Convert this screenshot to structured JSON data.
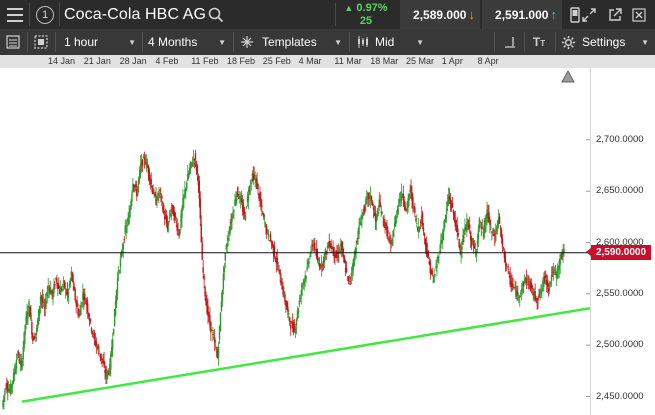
{
  "header": {
    "instrument_id": "1",
    "instrument_name": "Coca-Cola HBC AG",
    "change_pct": "0.97%",
    "change_pts": "25",
    "sell_price": "2,589.000",
    "buy_price": "2,591.000"
  },
  "toolbar": {
    "interval": "1 hour",
    "range": "4 Months",
    "templates": "Templates",
    "price_type": "Mid",
    "settings": "Settings"
  },
  "icons": {
    "menu": "hamburger-icon",
    "search": "search-icon",
    "mobile": "mobile-icon",
    "expand": "expand-icon",
    "popout": "popout-icon",
    "close": "close-icon"
  },
  "colors": {
    "up": "#2e9a2e",
    "down": "#c0181a",
    "trendline": "#41e841",
    "price_line": "#111111",
    "price_tag": "#c8102e"
  },
  "chart_data": {
    "type": "line",
    "x_ticks": [
      "14 Jan",
      "21 Jan",
      "28 Jan",
      "4 Feb",
      "11 Feb",
      "18 Feb",
      "25 Feb",
      "4 Mar",
      "11 Mar",
      "18 Mar",
      "25 Mar",
      "1 Apr",
      "8 Apr"
    ],
    "y_ticks": [
      "2,700.0000",
      "2,650.0000",
      "2,600.0000",
      "2,550.0000",
      "2,500.0000",
      "2,450.0000"
    ],
    "ylim": [
      2432,
      2770
    ],
    "current_price": "2,590.0000",
    "series": [
      {
        "values": [
          2440,
          2462,
          2455,
          2470,
          2492,
          2478,
          2520,
          2540,
          2505,
          2515,
          2548,
          2535,
          2558,
          2548,
          2565,
          2552,
          2560,
          2548,
          2570,
          2545,
          2528,
          2550,
          2540,
          2520,
          2505,
          2495,
          2485,
          2470,
          2478,
          2520,
          2565,
          2588,
          2612,
          2625,
          2660,
          2648,
          2675,
          2682,
          2670,
          2652,
          2640,
          2650,
          2628,
          2615,
          2635,
          2622,
          2608,
          2640,
          2660,
          2675,
          2684,
          2660,
          2580,
          2540,
          2520,
          2505,
          2488,
          2545,
          2590,
          2612,
          2630,
          2650,
          2640,
          2625,
          2650,
          2665,
          2660,
          2640,
          2622,
          2608,
          2600,
          2585,
          2570,
          2552,
          2535,
          2520,
          2515,
          2538,
          2560,
          2570,
          2590,
          2600,
          2580,
          2578,
          2590,
          2600,
          2592,
          2585,
          2598,
          2578,
          2560,
          2575,
          2598,
          2620,
          2632,
          2645,
          2642,
          2620,
          2638,
          2622,
          2610,
          2595,
          2618,
          2640,
          2648,
          2630,
          2652,
          2632,
          2612,
          2625,
          2598,
          2578,
          2562,
          2580,
          2600,
          2620,
          2645,
          2632,
          2615,
          2592,
          2608,
          2620,
          2600,
          2590,
          2620,
          2608,
          2630,
          2612,
          2605,
          2625,
          2595,
          2578,
          2562,
          2555,
          2548,
          2555,
          2565,
          2560,
          2550,
          2545,
          2552,
          2568,
          2556,
          2572,
          2568,
          2585,
          2590
        ]
      }
    ],
    "trendline": [
      [
        0,
        2445
      ],
      [
        1,
        2536
      ]
    ]
  }
}
